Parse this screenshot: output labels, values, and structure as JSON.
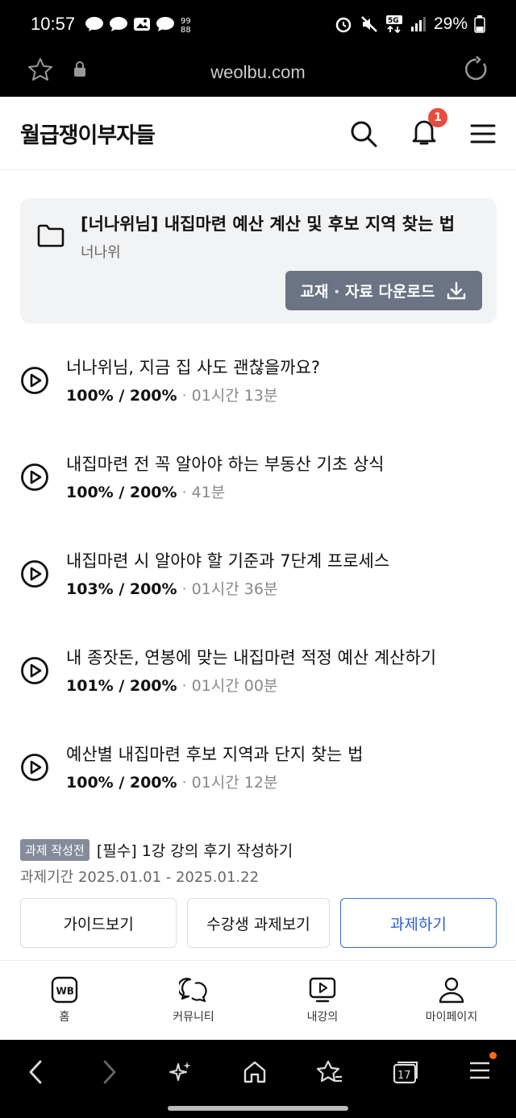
{
  "status_bar": {
    "time": "10:57",
    "battery": "29%",
    "network": "5G"
  },
  "browser": {
    "url": "weolbu.com"
  },
  "header": {
    "logo": "월급쟁이부자들",
    "notification_count": "1"
  },
  "course": {
    "title": "[너나위님] 내집마련 예산 계산 및 후보 지역 찾는 법",
    "author": "너나위",
    "download_label": "교재 · 자료 다운로드"
  },
  "lectures": [
    {
      "title": "너나위님, 지금 집 사도 괜찮을까요?",
      "progress": "100% / 200%",
      "duration": "01시간 13분"
    },
    {
      "title": "내집마련 전 꼭 알아야 하는 부동산 기초 상식",
      "progress": "100% / 200%",
      "duration": "41분"
    },
    {
      "title": "내집마련 시 알아야 할 기준과 7단계 프로세스",
      "progress": "103% / 200%",
      "duration": "01시간 36분"
    },
    {
      "title": "내 종잣돈, 연봉에 맞는 내집마련 적정 예산 계산하기",
      "progress": "101% / 200%",
      "duration": "01시간 00분"
    },
    {
      "title": "예산별 내집마련 후보 지역과 단지 찾는 법",
      "progress": "100% / 200%",
      "duration": "01시간 12분"
    }
  ],
  "assignment": {
    "badge": "과제 작성전",
    "title": "[필수] 1강 강의 후기 작성하기",
    "period": "과제기간 2025.01.01 - 2025.01.22",
    "guide_label": "가이드보기",
    "peers_label": "수강생 과제보기",
    "do_label": "과제하기"
  },
  "tabbar": {
    "logo_text": "WB",
    "items": [
      {
        "label": "홈",
        "icon": "wb-home-icon"
      },
      {
        "label": "커뮤니티",
        "icon": "chat-icon"
      },
      {
        "label": "내강의",
        "icon": "play-tv-icon"
      },
      {
        "label": "마이페이지",
        "icon": "person-icon"
      }
    ]
  },
  "browser_nav": {
    "tabs_count": "17"
  },
  "colors": {
    "accent_blue": "#2a5fce",
    "badge_red": "#e74c3c",
    "download_button": "#6b7384"
  }
}
